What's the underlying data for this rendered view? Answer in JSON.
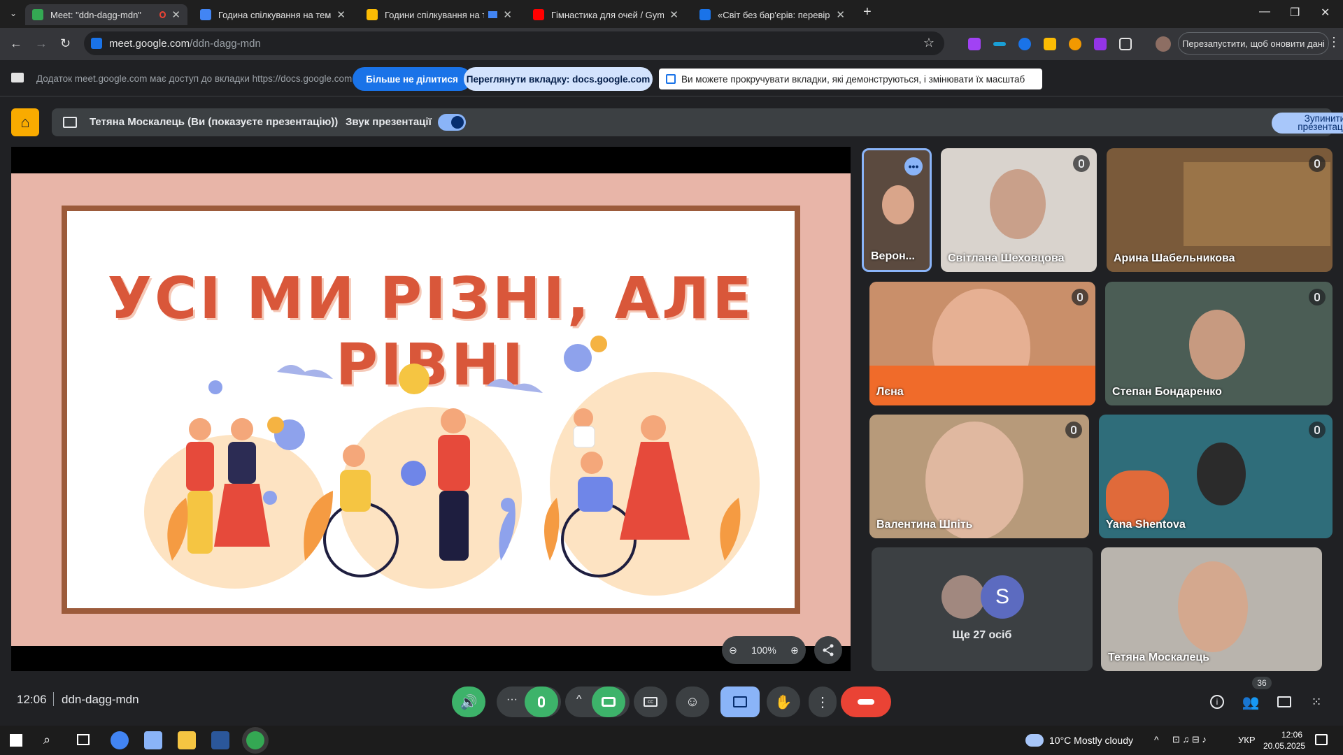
{
  "browser": {
    "tabs": [
      {
        "title": "Meet: \"ddn-dagg-mdn\"",
        "favicon": "meet-icon",
        "color": "#34a853",
        "active": true
      },
      {
        "title": "Година спілкування на тему: «",
        "favicon": "docs-icon",
        "color": "#4285f4",
        "active": false
      },
      {
        "title": "Години спілкування на тем",
        "favicon": "slides-icon",
        "color": "#fbbc04",
        "active": false
      },
      {
        "title": "Гімнастика для очей / Gymnas",
        "favicon": "youtube-icon",
        "color": "#ff0000",
        "active": false
      },
      {
        "title": "«Світ без бар'єрів: перевір се",
        "favicon": "site-icon",
        "color": "#1a73e8",
        "active": false
      }
    ],
    "url_host": "meet.google.com",
    "url_path": "/ddn-dagg-mdn",
    "relaunch_label": "Перезапустити, щоб оновити дані"
  },
  "share_bar": {
    "info": "Додаток meet.google.com має доступ до вкладки https://docs.google.com",
    "stop_label": "Більше не ділитися",
    "view_tab_label": "Переглянути вкладку: docs.google.com",
    "scroll_note": "Ви можете прокручувати вкладки, які демонструються, і змінювати їх масштаб"
  },
  "presenting": {
    "presenter": "Тетяна Москалець (Ви (показуєте презентацію))",
    "audio_label": "Звук презентації",
    "audio_on": true,
    "stop_label_line1": "Зупинити",
    "stop_label_line2": "презентацію"
  },
  "slide": {
    "title": "УСІ МИ РІЗНІ, АЛЕ РІВНІ",
    "zoom": "100%"
  },
  "participants": [
    {
      "name": "Верон...",
      "bg": "#5b4a3f",
      "speaking": true
    },
    {
      "name": "Світлана Шеховцова",
      "bg": "#d9d3cd",
      "muted": true
    },
    {
      "name": "Арина Шабельникова",
      "bg": "#7a5a3a",
      "muted": true
    },
    {
      "name": "Лєна",
      "bg": "#c98f6a",
      "muted": true
    },
    {
      "name": "Степан Бондаренко",
      "bg": "#4b5d55",
      "muted": true
    },
    {
      "name": "Валентина Шпіть",
      "bg": "#b79a7a",
      "muted": true
    },
    {
      "name": "Yana Shentova",
      "bg": "#2f6d7a",
      "muted": true
    },
    {
      "name": "Тетяна Москалець",
      "bg": "#b9b4ad"
    }
  ],
  "others": {
    "label": "Ще 27 осіб",
    "avatar_letter": "S"
  },
  "controls": {
    "time": "12:06",
    "meeting_code": "ddn-dagg-mdn",
    "people_count": "36"
  },
  "taskbar": {
    "weather_temp": "10°C",
    "weather_text": "Mostly cloudy",
    "lang": "УКР",
    "time": "12:06",
    "date": "20.05.2025"
  }
}
